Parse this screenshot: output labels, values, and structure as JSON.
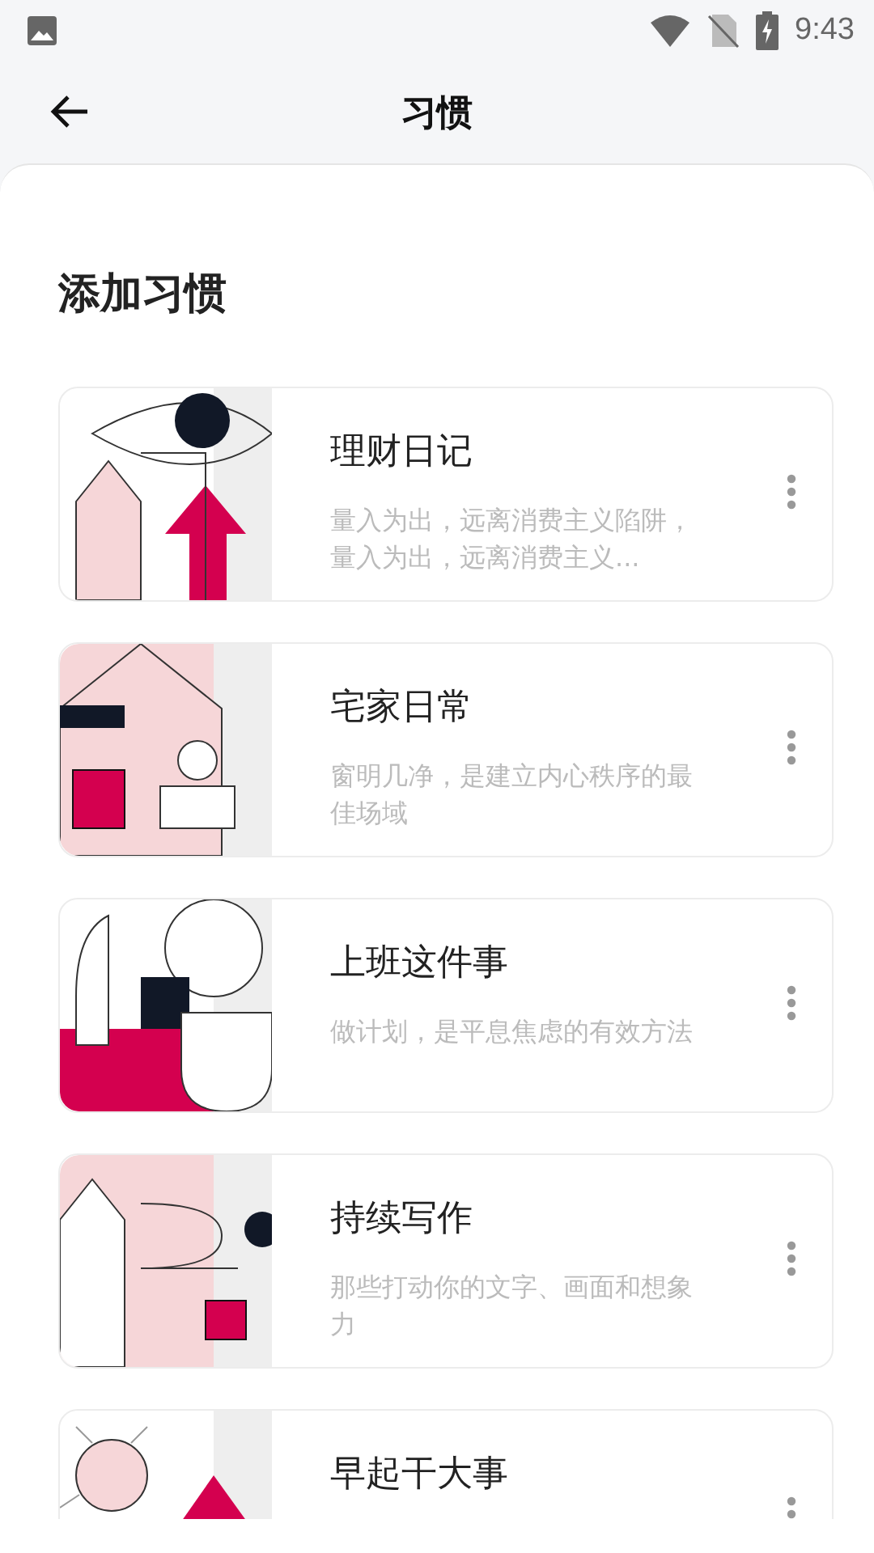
{
  "status_bar": {
    "time": "9:43"
  },
  "toolbar": {
    "title": "习惯"
  },
  "section": {
    "heading": "添加习惯"
  },
  "habits": [
    {
      "title": "理财日记",
      "subtitle": "量入为出，远离消费主义陷阱，量入为出，远离消费主义..."
    },
    {
      "title": "宅家日常",
      "subtitle": "窗明几净，是建立内心秩序的最佳场域"
    },
    {
      "title": "上班这件事",
      "subtitle": "做计划，是平息焦虑的有效方法"
    },
    {
      "title": "持续写作",
      "subtitle": "那些打动你的文字、画面和想象力"
    },
    {
      "title": "早起干大事"
    }
  ]
}
